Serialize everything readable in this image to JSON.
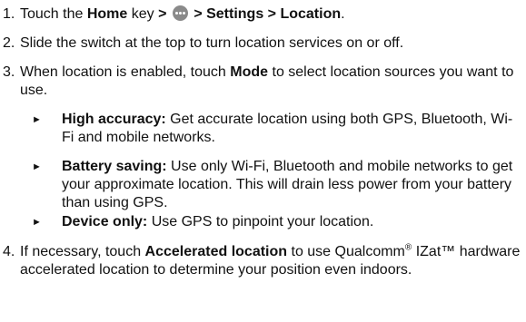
{
  "steps": [
    {
      "num": "1.",
      "parts": {
        "a": "Touch the ",
        "b": "Home",
        "c": " key ",
        "d": ">",
        "e": " ",
        "f": " > Settings > Location",
        "g": "."
      }
    },
    {
      "num": "2.",
      "text": "Slide the switch at the top to turn location services on or off."
    },
    {
      "num": "3.",
      "parts": {
        "a": "When location is enabled, touch ",
        "b": "Mode",
        "c": " to select location sources you want to use."
      }
    },
    {
      "num": "4.",
      "parts": {
        "a": "If necessary, touch ",
        "b": "Accelerated location",
        "c": " to use Qualcomm",
        "sup": "®",
        "d": " IZat™ hardware accelerated location to determine your position even indoors."
      }
    }
  ],
  "bullets": [
    {
      "marker": "►",
      "title": "High accuracy:",
      "text": " Get accurate location using both GPS, Bluetooth, Wi-Fi and mobile networks."
    },
    {
      "marker": "►",
      "title": "Battery saving:",
      "text": " Use only Wi-Fi, Bluetooth and mobile networks to get your approximate location. This will drain less power from your battery than using GPS."
    },
    {
      "marker": "►",
      "title": "Device only:",
      "text": " Use GPS to pinpoint your location."
    }
  ],
  "icons": {
    "menu": "all-apps-menu-icon"
  }
}
